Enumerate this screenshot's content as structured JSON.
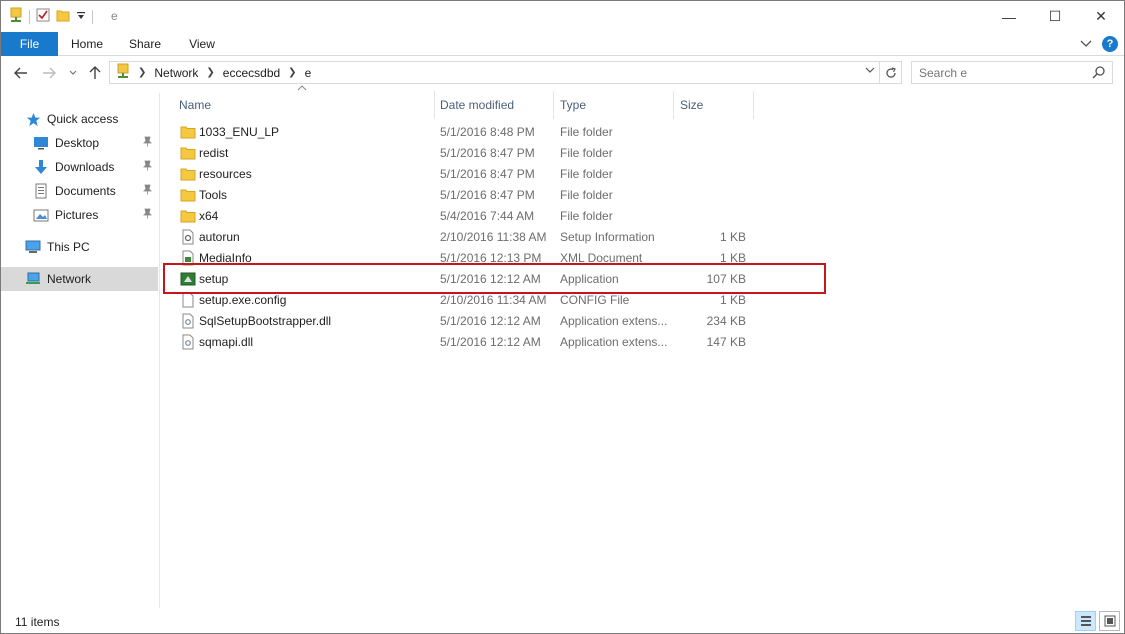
{
  "window": {
    "title": "e",
    "caption": {
      "minimize": "—",
      "maximize": "☐",
      "close": "✕"
    }
  },
  "ribbon": {
    "tabs": [
      "File",
      "Home",
      "Share",
      "View"
    ]
  },
  "address": {
    "breadcrumbs": [
      "Network",
      "eccecsdbd",
      "e"
    ],
    "search_placeholder": "Search e"
  },
  "nav_pane": {
    "items": [
      {
        "label": "Quick access",
        "icon": "star-icon"
      },
      {
        "label": "Desktop",
        "icon": "desktop-icon",
        "pinned": true
      },
      {
        "label": "Downloads",
        "icon": "download-icon",
        "pinned": true
      },
      {
        "label": "Documents",
        "icon": "documents-icon",
        "pinned": true
      },
      {
        "label": "Pictures",
        "icon": "pictures-icon",
        "pinned": true
      },
      {
        "label": "This PC",
        "icon": "computer-icon"
      },
      {
        "label": "Network",
        "icon": "network-icon",
        "selected": true
      }
    ]
  },
  "file_list": {
    "columns": [
      "Name",
      "Date modified",
      "Type",
      "Size"
    ],
    "rows": [
      {
        "name": "1033_ENU_LP",
        "date": "5/1/2016 8:48 PM",
        "type": "File folder",
        "size": "",
        "icon": "folder-icon"
      },
      {
        "name": "redist",
        "date": "5/1/2016 8:47 PM",
        "type": "File folder",
        "size": "",
        "icon": "folder-icon"
      },
      {
        "name": "resources",
        "date": "5/1/2016 8:47 PM",
        "type": "File folder",
        "size": "",
        "icon": "folder-icon"
      },
      {
        "name": "Tools",
        "date": "5/1/2016 8:47 PM",
        "type": "File folder",
        "size": "",
        "icon": "folder-icon"
      },
      {
        "name": "x64",
        "date": "5/4/2016 7:44 AM",
        "type": "File folder",
        "size": "",
        "icon": "folder-icon"
      },
      {
        "name": "autorun",
        "date": "2/10/2016 11:38 AM",
        "type": "Setup Information",
        "size": "1 KB",
        "icon": "settings-file-icon"
      },
      {
        "name": "MediaInfo",
        "date": "5/1/2016 12:13 PM",
        "type": "XML Document",
        "size": "1 KB",
        "icon": "xml-file-icon"
      },
      {
        "name": "setup",
        "date": "5/1/2016 12:12 AM",
        "type": "Application",
        "size": "107 KB",
        "icon": "application-icon",
        "highlighted": true
      },
      {
        "name": "setup.exe.config",
        "date": "2/10/2016 11:34 AM",
        "type": "CONFIG File",
        "size": "1 KB",
        "icon": "file-icon"
      },
      {
        "name": "SqlSetupBootstrapper.dll",
        "date": "5/1/2016 12:12 AM",
        "type": "Application extens...",
        "size": "234 KB",
        "icon": "dll-file-icon"
      },
      {
        "name": "sqmapi.dll",
        "date": "5/1/2016 12:12 AM",
        "type": "Application extens...",
        "size": "147 KB",
        "icon": "dll-file-icon"
      }
    ]
  },
  "status": {
    "item_count": "11 items"
  },
  "colors": {
    "accent": "#1979ca",
    "highlight_border": "#c4161c",
    "folder": "#f5c842",
    "nav_selected": "#d9d9d9"
  }
}
